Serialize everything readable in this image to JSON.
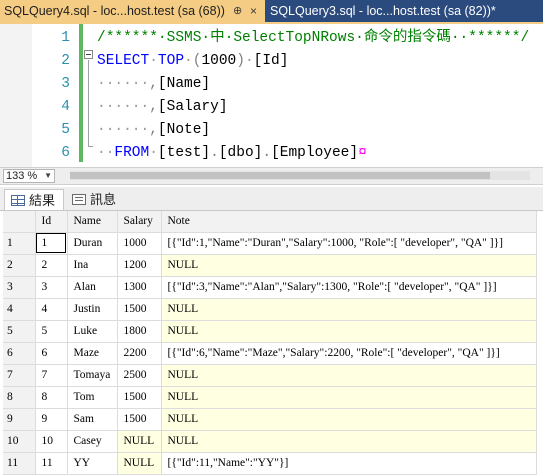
{
  "tabs": [
    {
      "label": "SQLQuery4.sql - loc...host.test (sa (68))",
      "pin": "⊕",
      "close": "×",
      "active": true
    },
    {
      "label": "SQLQuery3.sql - loc...host.test (sa (82))*",
      "active": false
    }
  ],
  "editor": {
    "lines": [
      {
        "num": "1",
        "parts": [
          {
            "cls": "c-comment",
            "text": "/******·SSMS·中·SelectTopNRows·命令的指令碼··******/"
          }
        ]
      },
      {
        "num": "2",
        "parts": [
          {
            "cls": "c-kw",
            "text": "SELECT"
          },
          {
            "cls": "c-dot",
            "text": "·"
          },
          {
            "cls": "c-kw",
            "text": "TOP"
          },
          {
            "cls": "c-dot",
            "text": "·"
          },
          {
            "cls": "c-gray",
            "text": "("
          },
          {
            "cls": "c-black",
            "text": "1000"
          },
          {
            "cls": "c-gray",
            "text": ")"
          },
          {
            "cls": "c-dot",
            "text": "·"
          },
          {
            "cls": "c-black",
            "text": "[Id]"
          }
        ]
      },
      {
        "num": "3",
        "parts": [
          {
            "cls": "c-dot",
            "text": "······"
          },
          {
            "cls": "c-gray",
            "text": ","
          },
          {
            "cls": "c-black",
            "text": "[Name]"
          }
        ]
      },
      {
        "num": "4",
        "parts": [
          {
            "cls": "c-dot",
            "text": "······"
          },
          {
            "cls": "c-gray",
            "text": ","
          },
          {
            "cls": "c-black",
            "text": "[Salary]"
          }
        ]
      },
      {
        "num": "5",
        "parts": [
          {
            "cls": "c-dot",
            "text": "······"
          },
          {
            "cls": "c-gray",
            "text": ","
          },
          {
            "cls": "c-black",
            "text": "[Note]"
          }
        ]
      },
      {
        "num": "6",
        "parts": [
          {
            "cls": "c-dot",
            "text": "··"
          },
          {
            "cls": "c-kw",
            "text": "FROM"
          },
          {
            "cls": "c-dot",
            "text": "·"
          },
          {
            "cls": "c-black",
            "text": "[test]"
          },
          {
            "cls": "c-gray",
            "text": "."
          },
          {
            "cls": "c-black",
            "text": "[dbo]"
          },
          {
            "cls": "c-gray",
            "text": "."
          },
          {
            "cls": "c-black",
            "text": "[Employee]"
          },
          {
            "cls": "c-pink",
            "text": "¤"
          }
        ]
      }
    ]
  },
  "zoom": {
    "value": "133 %"
  },
  "results_tabs": [
    {
      "label": "結果",
      "icon": "grid-icon"
    },
    {
      "label": "訊息",
      "icon": "message-icon"
    }
  ],
  "grid": {
    "columns": [
      "Id",
      "Name",
      "Salary",
      "Note"
    ],
    "rows": [
      {
        "num": "1",
        "cells": [
          "1",
          "Duran",
          "1000",
          "[{\"Id\":1,\"Name\":\"Duran\",\"Salary\":1000, \"Role\":[ \"developer\", \"QA\" ]}]"
        ],
        "nulls": [
          false,
          false,
          false,
          false
        ]
      },
      {
        "num": "2",
        "cells": [
          "2",
          "Ina",
          "1200",
          "NULL"
        ],
        "nulls": [
          false,
          false,
          false,
          true
        ]
      },
      {
        "num": "3",
        "cells": [
          "3",
          "Alan",
          "1300",
          "[{\"Id\":3,\"Name\":\"Alan\",\"Salary\":1300, \"Role\":[ \"developer\", \"QA\" ]}]"
        ],
        "nulls": [
          false,
          false,
          false,
          false
        ]
      },
      {
        "num": "4",
        "cells": [
          "4",
          "Justin",
          "1500",
          "NULL"
        ],
        "nulls": [
          false,
          false,
          false,
          true
        ]
      },
      {
        "num": "5",
        "cells": [
          "5",
          "Luke",
          "1800",
          "NULL"
        ],
        "nulls": [
          false,
          false,
          false,
          true
        ]
      },
      {
        "num": "6",
        "cells": [
          "6",
          "Maze",
          "2200",
          "[{\"Id\":6,\"Name\":\"Maze\",\"Salary\":2200, \"Role\":[ \"developer\", \"QA\" ]}]"
        ],
        "nulls": [
          false,
          false,
          false,
          false
        ]
      },
      {
        "num": "7",
        "cells": [
          "7",
          "Tomaya",
          "2500",
          "NULL"
        ],
        "nulls": [
          false,
          false,
          false,
          true
        ]
      },
      {
        "num": "8",
        "cells": [
          "8",
          "Tom",
          "1500",
          "NULL"
        ],
        "nulls": [
          false,
          false,
          false,
          true
        ]
      },
      {
        "num": "9",
        "cells": [
          "9",
          "Sam",
          "1500",
          "NULL"
        ],
        "nulls": [
          false,
          false,
          false,
          true
        ]
      },
      {
        "num": "10",
        "cells": [
          "10",
          "Casey",
          "NULL",
          "NULL"
        ],
        "nulls": [
          false,
          false,
          true,
          true
        ]
      },
      {
        "num": "11",
        "cells": [
          "11",
          "YY",
          "NULL",
          "[{\"Id\":11,\"Name\":\"YY\"}]"
        ],
        "nulls": [
          false,
          false,
          true,
          false
        ]
      }
    ]
  },
  "colors": {
    "tab_active": "#f5cc84",
    "tab_strip": "#2b4a7e",
    "keyword": "#0000ff",
    "comment": "#008000",
    "line_number": "#2b91af",
    "null_cell": "#ffffe1"
  }
}
